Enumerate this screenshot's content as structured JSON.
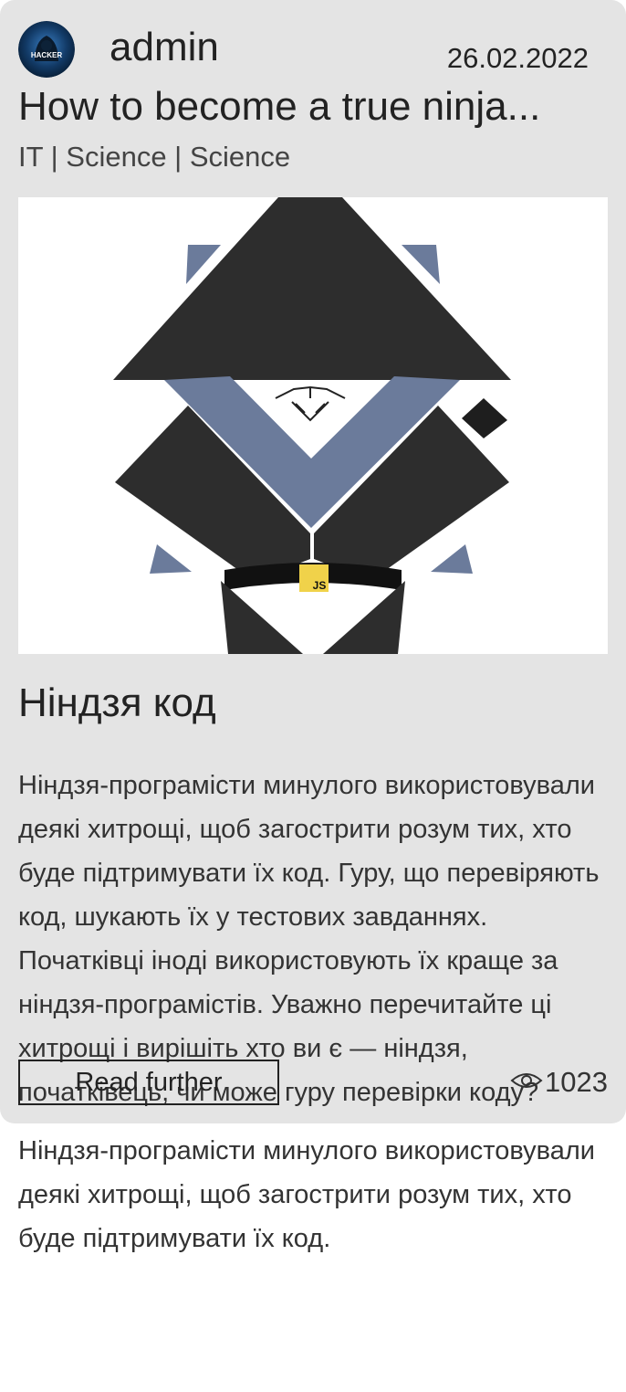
{
  "post": {
    "author": "admin",
    "date": "26.02.2022",
    "title": "How to become a true ninja...",
    "categories": "IT | Science | Science",
    "avatar_caption": "HACKER",
    "image_badge": "JS",
    "heading": "Ніндзя код",
    "paragraphs": [
      "Ніндзя-програмісти минулого використовували деякі хитрощі, щоб загострити розум тих, хто буде підтримувати їх код. Гуру, що перевіряють код, шукають їх у тестових завданнях. Початківці іноді використовують їх краще за ніндзя-програмістів. Уважно перечитайте ці хитрощі і вирішіть хто ви є — ніндзя, початківець, чи може гуру перевірки коду?",
      "Ніндзя-програмісти минулого використовували деякі хитрощі, щоб загострити розум тих, хто буде підтримувати їх код."
    ],
    "read_button": "Read further",
    "views": "1023",
    "icons": {
      "views": "eye-icon"
    }
  },
  "colors": {
    "card_bg": "#e4e4e4",
    "ninja_dark": "#2d2d2d",
    "ninja_blue": "#6b7b9b",
    "js_yellow": "#f0d24a"
  }
}
